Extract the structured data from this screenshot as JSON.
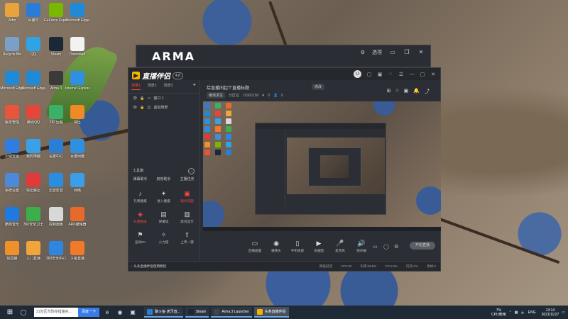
{
  "desktop": {
    "icons": [
      {
        "label": "Adm",
        "color": "#e8a43a"
      },
      {
        "label": "百播号",
        "color": "#2b7bd8"
      },
      {
        "label": "GeForce Experience",
        "color": "#76b900"
      },
      {
        "label": "Microsoft Edge",
        "color": "#1f8ad8"
      },
      {
        "label": "Recycle Bin",
        "color": "#7aa0c8"
      },
      {
        "label": "QQ",
        "color": "#2ea3e6"
      },
      {
        "label": "Steam",
        "color": "#1b2838"
      },
      {
        "label": "Download",
        "color": "#f2f2f2"
      },
      {
        "label": "Microsoft Edge",
        "color": "#1f8ad8"
      },
      {
        "label": "Microsoft Edge",
        "color": "#1f8ad8"
      },
      {
        "label": "Arma 3",
        "color": "#3a3a3a"
      },
      {
        "label": "Internet Explorer",
        "color": "#2f8fe0"
      },
      {
        "label": "版本管理",
        "color": "#e8553a"
      },
      {
        "label": "腾讯QQ",
        "color": "#e4463a"
      },
      {
        "label": "ZIP 压缩",
        "color": "#3ab06a"
      },
      {
        "label": "快压",
        "color": "#f08a24"
      },
      {
        "label": "火绒安全",
        "color": "#2f7de0"
      },
      {
        "label": "我的电脑",
        "color": "#3aa0e8"
      },
      {
        "label": "设置中心",
        "color": "#2a7fd4"
      },
      {
        "label": "百度网盘",
        "color": "#2f8fe0"
      },
      {
        "label": "系统设置",
        "color": "#4a8ad8"
      },
      {
        "label": "快压解压",
        "color": "#e03a3a"
      },
      {
        "label": "迅雷影音",
        "color": "#2a8ee0"
      },
      {
        "label": "网络",
        "color": "#3a9ee8"
      },
      {
        "label": "酷狗音乐",
        "color": "#1e7ae0"
      },
      {
        "label": "360安全卫士",
        "color": "#3ab04a"
      },
      {
        "label": "控制面板",
        "color": "#d8d8d8"
      },
      {
        "label": "ARK编辑器",
        "color": "#e86a2a"
      },
      {
        "label": "快直播",
        "color": "#f0902a"
      },
      {
        "label": "入门直播",
        "color": "#f0a53a"
      },
      {
        "label": "360安全中心",
        "color": "#2f86e0"
      },
      {
        "label": "斗鱼直播",
        "color": "#f07a2a"
      }
    ]
  },
  "back_window": {
    "title": "ARMA",
    "settings_label": "选项",
    "min": "▭",
    "restore": "❐",
    "close": "✕"
  },
  "app": {
    "brand": "直播伴侣",
    "version": "4.8",
    "avatar": "U",
    "titlebar_icons": [
      "▢",
      "▣",
      "◌",
      "☰",
      "—",
      "▢",
      "✕"
    ],
    "scene_tabs": [
      "场景1",
      "场景2",
      "场景3"
    ],
    "sources": [
      {
        "label": "窗口 1"
      },
      {
        "label": "虚拟场景"
      }
    ],
    "tools_title": "工具箱",
    "tools_top": [
      "弹幕助手",
      "房管助手",
      "主播任务"
    ],
    "tools": [
      {
        "label": "礼物播报",
        "icon": "♪",
        "red": false
      },
      {
        "label": "进入播报",
        "icon": "✦",
        "red": false
      },
      {
        "label": "观众答题",
        "icon": "▣",
        "red": true
      },
      {
        "label": "礼物连击",
        "icon": "◈",
        "red": true
      },
      {
        "label": "弹幕墙",
        "icon": "▤",
        "red": false
      },
      {
        "label": "歌词显示",
        "icon": "▥",
        "red": false
      },
      {
        "label": "全局PK",
        "icon": "⚑",
        "red": false
      },
      {
        "label": "火力值",
        "icon": "✧",
        "red": false
      },
      {
        "label": "上传一键",
        "icon": "⇧",
        "red": false
      }
    ],
    "room": {
      "title": "给直播间起个直播标题",
      "edit": "修改",
      "category": "绝地求生",
      "tag": "分区位",
      "room_id": "10302156",
      "likes": "0",
      "viewers": "0"
    },
    "info_icons": [
      "⊞",
      "⌂",
      "▣",
      "🔔",
      "⤴"
    ],
    "controls": [
      {
        "label": "直播画面",
        "icon": "▭",
        "style": ""
      },
      {
        "label": "摄像头",
        "icon": "◉",
        "style": ""
      },
      {
        "label": "手机投屏",
        "icon": "▯",
        "style": ""
      },
      {
        "label": "多画面",
        "icon": "▶",
        "style": ""
      },
      {
        "label": "麦克风",
        "icon": "🎤",
        "style": "red"
      },
      {
        "label": "扬声器",
        "icon": "🔊",
        "style": "orange"
      }
    ],
    "small_icons": [
      "▭",
      "◯",
      "⚙"
    ],
    "live_button": "开始直播",
    "status": {
      "hint_prefix": "!",
      "hint": "头条直播伴侣使用教程",
      "stats": [
        "网络延迟",
        "FPS:60",
        "码率:0KB/s",
        "CPU:9%",
        "内存:0%",
        "丢帧:0"
      ]
    }
  },
  "taskbar": {
    "start_icon": "⊞",
    "search_placeholder": "21省区市防控措施实...",
    "search_button": "百度一下",
    "pinned_icons": [
      "e",
      "◉",
      "▣"
    ],
    "tasks": [
      {
        "label": "聊斗鱼·虎牙直...",
        "color": "#2a7fd4",
        "active": false
      },
      {
        "label": "Steam",
        "color": "#1b2838",
        "active": false
      },
      {
        "label": "Arma 3 Launcher",
        "color": "#444",
        "active": false
      },
      {
        "label": "头条直播伴侣",
        "color": "#f5b400",
        "active": true
      }
    ],
    "cpu_value": "7%",
    "cpu_label": "CPU使用",
    "lang": "ENG",
    "time": "13:14",
    "date": "2021/11/27"
  }
}
